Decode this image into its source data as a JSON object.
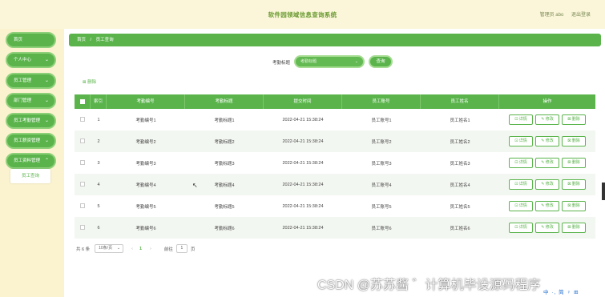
{
  "header": {
    "title": "软件园领域信息查询系统",
    "user_label": "管理员 abo",
    "logout_label": "退出登录"
  },
  "sidebar": {
    "items": [
      {
        "label": "首页",
        "has_chevron": false
      },
      {
        "label": "个人中心",
        "has_chevron": true
      },
      {
        "label": "员工管理",
        "has_chevron": true
      },
      {
        "label": "部门管理",
        "has_chevron": true
      },
      {
        "label": "员工考勤管理",
        "has_chevron": true
      },
      {
        "label": "员工薪资管理",
        "has_chevron": true
      },
      {
        "label": "员工资料管理",
        "has_chevron": true
      }
    ],
    "submenu_item": "员工查询"
  },
  "breadcrumb": {
    "home": "首页",
    "separator": "/",
    "current": "员工查询"
  },
  "search": {
    "label": "考勤标题",
    "placeholder": "考勤标题",
    "button": "查询"
  },
  "toolbar": {
    "delete_label": "删除"
  },
  "table": {
    "columns": [
      "",
      "索引",
      "考勤编号",
      "考勤标题",
      "提交时间",
      "员工账号",
      "员工姓名",
      "操作"
    ],
    "rows": [
      [
        "1",
        "考勤编号1",
        "考勤标题1",
        "2022-04-21 15:38:24",
        "员工账号1",
        "员工姓名1"
      ],
      [
        "2",
        "考勤编号2",
        "考勤标题2",
        "2022-04-21 15:38:24",
        "员工账号2",
        "员工姓名2"
      ],
      [
        "3",
        "考勤编号3",
        "考勤标题3",
        "2022-04-21 15:38:24",
        "员工账号3",
        "员工姓名3"
      ],
      [
        "4",
        "考勤编号4",
        "考勤标题4",
        "2022-04-21 15:38:24",
        "员工账号4",
        "员工姓名4"
      ],
      [
        "5",
        "考勤编号5",
        "考勤标题5",
        "2022-04-21 15:38:24",
        "员工账号5",
        "员工姓名5"
      ],
      [
        "6",
        "考勤编号6",
        "考勤标题6",
        "2022-04-21 15:38:24",
        "员工账号6",
        "员工姓名6"
      ]
    ],
    "actions": [
      "详情",
      "修改",
      "删除"
    ]
  },
  "pagination": {
    "total": "共 6 条",
    "page_size": "10条/页",
    "prev": "‹",
    "current_page": "1",
    "next": "›",
    "goto_prefix": "前往",
    "goto_value": "1",
    "goto_suffix": "页"
  },
  "overlay": {
    "watermark": "CSDN @苏苏酱 ゛计算机毕设源码程序",
    "ime": "中 ·, 简 ♀ ⊞"
  },
  "colors": {
    "primary_green": "#5ab44b",
    "header_bg": "#fbf6d9",
    "sidebar_bg": "#fbf3cf",
    "title_green": "#6a9a31"
  }
}
